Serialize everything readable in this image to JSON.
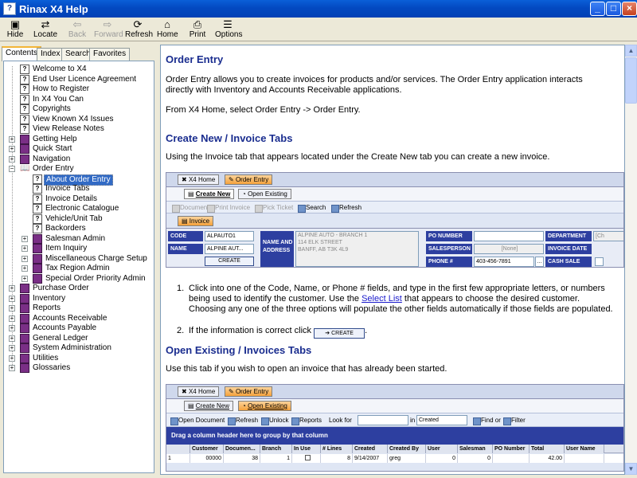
{
  "window": {
    "title": "Rinax X4 Help",
    "controls": [
      "_",
      "□",
      "×"
    ]
  },
  "toolbar": {
    "buttons": [
      {
        "label": "Hide",
        "icon": "hide-icon",
        "glyph": "▣"
      },
      {
        "label": "Locate",
        "icon": "locate-icon",
        "glyph": "⇄"
      },
      {
        "label": "Back",
        "icon": "back-arrow-icon",
        "glyph": "⇦"
      },
      {
        "label": "Forward",
        "icon": "forward-arrow-icon",
        "glyph": "⇨"
      },
      {
        "label": "Refresh",
        "icon": "refresh-icon",
        "glyph": "⟳"
      },
      {
        "label": "Home",
        "icon": "home-icon",
        "glyph": "⌂"
      },
      {
        "label": "Print",
        "icon": "printer-icon",
        "glyph": "⎙"
      },
      {
        "label": "Options",
        "icon": "options-icon",
        "glyph": "☰"
      }
    ]
  },
  "nav_tabs": [
    "Contents",
    "Index",
    "Search",
    "Favorites"
  ],
  "tree": [
    {
      "label": "Welcome to X4",
      "icon": "page"
    },
    {
      "label": "End User Licence Agreement",
      "icon": "page"
    },
    {
      "label": "How to Register",
      "icon": "page"
    },
    {
      "label": "In X4 You Can",
      "icon": "page"
    },
    {
      "label": "Copyrights",
      "icon": "page"
    },
    {
      "label": "View Known X4 Issues",
      "icon": "page"
    },
    {
      "label": "View Release Notes",
      "icon": "page"
    },
    {
      "label": "Getting Help",
      "icon": "book"
    },
    {
      "label": "Quick Start",
      "icon": "book"
    },
    {
      "label": "Navigation",
      "icon": "book"
    },
    {
      "label": "Order Entry",
      "icon": "openbook"
    },
    {
      "label": "About Order Entry",
      "icon": "page"
    },
    {
      "label": "Invoice Tabs",
      "icon": "page"
    },
    {
      "label": "Invoice Details",
      "icon": "page"
    },
    {
      "label": "Electronic Catalogue",
      "icon": "page"
    },
    {
      "label": "Vehicle/Unit Tab",
      "icon": "page"
    },
    {
      "label": "Backorders",
      "icon": "page"
    },
    {
      "label": "Salesman Admin",
      "icon": "book"
    },
    {
      "label": "Item Inquiry",
      "icon": "book"
    },
    {
      "label": "Miscellaneous Charge Setup",
      "icon": "book"
    },
    {
      "label": "Tax Region Admin",
      "icon": "book"
    },
    {
      "label": "Special Order Priority Admin",
      "icon": "book"
    },
    {
      "label": "Purchase Order",
      "icon": "book"
    },
    {
      "label": "Inventory",
      "icon": "book"
    },
    {
      "label": "Reports",
      "icon": "book"
    },
    {
      "label": "Accounts Receivable",
      "icon": "book"
    },
    {
      "label": "Accounts Payable",
      "icon": "book"
    },
    {
      "label": "General Ledger",
      "icon": "book"
    },
    {
      "label": "System Administration",
      "icon": "book"
    },
    {
      "label": "Utilities",
      "icon": "book"
    },
    {
      "label": "Glossaries",
      "icon": "book"
    }
  ],
  "content": {
    "title": "Order Entry",
    "intro": "Order Entry allows you to create invoices for products and/or services. The Order Entry application interacts directly with Inventory and Accounts Receivable applications.",
    "path": "From X4 Home, select Order Entry -> Order Entry.",
    "section1_title": "Create New / Invoice Tabs",
    "section1_text": "Using the Invoice tab that appears located under the Create New tab you can create a new invoice.",
    "step1_num": "1.",
    "step1_a": "Click into one of the Code, Name, or Phone # fields, and type in the first few appropriate letters, or numbers being used to identify the customer. Use the ",
    "step1_link": "Select List",
    "step1_b": " that appears to choose the desired customer. Choosing any one of the three options will populate the other fields automatically if those fields are populated.",
    "step2_num": "2.",
    "step2_text": "If the information is correct click",
    "step2_btn": "CREATE",
    "step2_end": ".",
    "section2_title": "Open Existing / Invoices Tabs",
    "section2_text": "Use this tab if you wish to open an invoice that has already been started."
  },
  "shot1": {
    "tabs": [
      "X4 Home",
      "Order Entry"
    ],
    "subtabs": [
      "Create New",
      "Open Existing"
    ],
    "toolbar": [
      "Document",
      "Print Invoice",
      "Pick Ticket",
      "Search",
      "Refresh"
    ],
    "invoice_tab": "Invoice",
    "code_label": "CODE",
    "code_value": "ALPAUTO1",
    "name_label": "NAME",
    "name_value": "ALPINE AUT...",
    "create": "CREATE",
    "name_addr_label": "NAME AND ADDRESS",
    "address": [
      "ALPINE AUTO - BRANCH 1",
      "114 ELK STREET",
      "BANFF, AB T3K 4L9"
    ],
    "po_label": "PO NUMBER",
    "sales_label": "SALESPERSON",
    "sales_value": "[None]",
    "phone_label": "PHONE #",
    "phone_value": "403-456-7891",
    "dept_label": "DEPARTMENT",
    "dept_value": "[Ch",
    "inv_date_label": "INVOICE DATE",
    "cash_label": "CASH SALE"
  },
  "shot2": {
    "tabs": [
      "X4 Home",
      "Order Entry"
    ],
    "subtabs": [
      "Create New",
      "Open Existing"
    ],
    "toolbar": [
      "Open Document",
      "Refresh",
      "Unlock",
      "Reports"
    ],
    "lookfor": "Look for",
    "in_label": "in",
    "in_value": "Created",
    "findor": "Find or",
    "filter": "Filter",
    "group_hint": "Drag a column header here to group by that column",
    "columns": [
      "",
      "Customer",
      "Documen...",
      "Branch",
      "In Use",
      "# Lines",
      "Created",
      "Created By",
      "User",
      "Salesman",
      "PO Number",
      "Total",
      "User Name"
    ],
    "row": [
      "1",
      "00000",
      "38",
      "1",
      "",
      "8",
      "9/14/2007",
      "greg",
      "0",
      "0",
      "",
      "42.00",
      ""
    ]
  }
}
